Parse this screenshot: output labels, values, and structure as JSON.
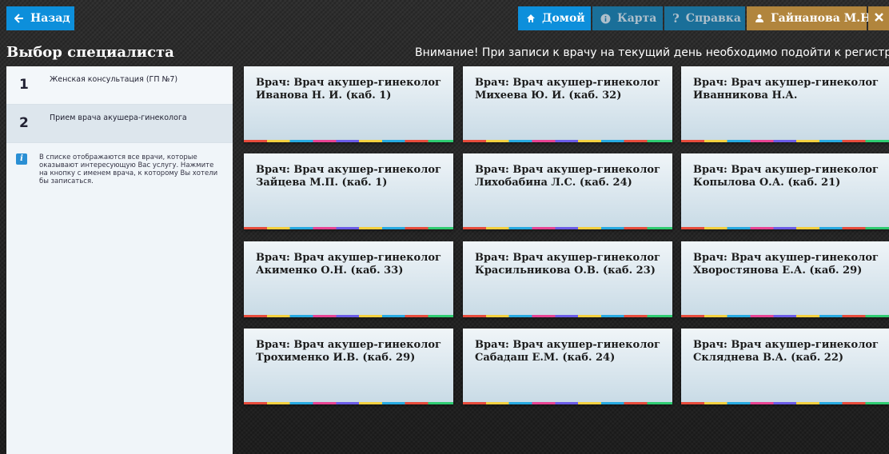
{
  "topbar": {
    "back_label": "Назад",
    "home_label": "Домой",
    "map_label": "Карта",
    "help_label": "Справка",
    "user_label": "Гайнанова М.Н."
  },
  "page": {
    "title": "Выбор специалиста",
    "notice": "Внимание! При записи к врачу на текущий день необходимо подойти к регистрато"
  },
  "sidebar": {
    "steps": [
      {
        "num": "1",
        "label": "Женская консультация (ГП №7)"
      },
      {
        "num": "2",
        "label": "Прием врача акушера-гинеколога"
      }
    ],
    "info": "В списке отображаются все врачи, которые оказывают интересующую Вас услугу. Нажмите на кнопку с именем врача, к которому Вы хотели бы записаться."
  },
  "doctors": [
    {
      "line1": "Врач: Врач акушер-гинеколог",
      "line2": "Иванова Н. И. (каб. 1)"
    },
    {
      "line1": "Врач: Врач акушер-гинеколог",
      "line2": "Михеева Ю. И. (каб. 32)"
    },
    {
      "line1": "Врач: Врач акушер-гинеколог",
      "line2": "Иванникова Н.А."
    },
    {
      "line1": "Врач: Врач акушер-гинеколог",
      "line2": "Зайцева М.П. (каб. 1)"
    },
    {
      "line1": "Врач: Врач акушер-гинеколог",
      "line2": "Лихобабина Л.С. (каб. 24)"
    },
    {
      "line1": "Врач: Врач акушер-гинеколог",
      "line2": "Копылова О.А. (каб. 21)"
    },
    {
      "line1": "Врач: Врач акушер-гинеколог",
      "line2": "Акименко О.Н. (каб. 33)"
    },
    {
      "line1": "Врач: Врач акушер-гинеколог",
      "line2": "Красильникова О.В. (каб. 23)"
    },
    {
      "line1": "Врач: Врач акушер-гинеколог",
      "line2": "Хворостянова Е.А. (каб. 29)"
    },
    {
      "line1": "Врач: Врач акушер-гинеколог",
      "line2": "Трохименко И.В. (каб. 29)"
    },
    {
      "line1": "Врач: Врач акушер-гинеколог",
      "line2": "Сабадаш Е.М. (каб. 24)"
    },
    {
      "line1": "Врач: Врач акушер-гинеколог",
      "line2": "Скляднева В.А. (каб. 22)"
    }
  ],
  "colors": {
    "primary_button": "#0d8fdb",
    "disabled_button": "#1a6f99",
    "user_button": "#b1853d"
  }
}
